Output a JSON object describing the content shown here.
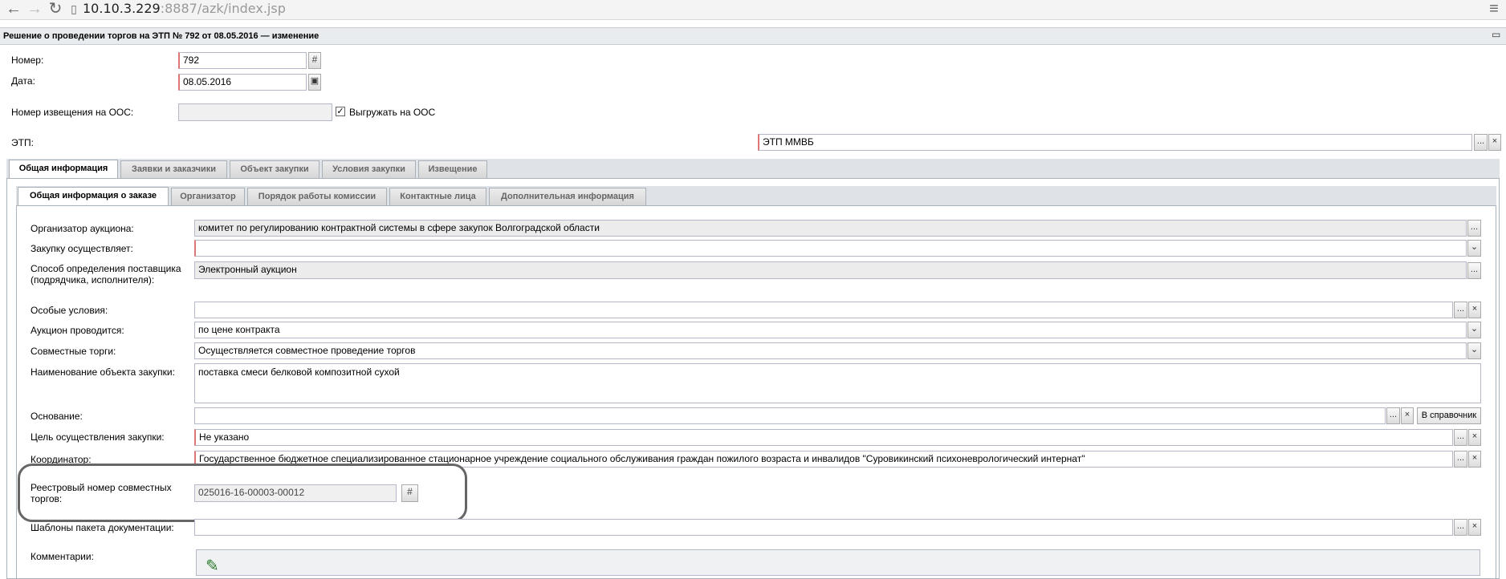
{
  "browser": {
    "back_icon": "←",
    "forward_icon": "→",
    "reload_icon": "↻",
    "page_icon": "▯",
    "url_host": "10.10.3.229",
    "url_rest": ":8887/azk/index.jsp",
    "menu_icon": "≡"
  },
  "window": {
    "title": "Решение о проведении торгов на ЭТП № 792 от 08.05.2016 — изменение",
    "maximize_icon": "▭"
  },
  "header": {
    "number_label": "Номер:",
    "number_value": "792",
    "date_label": "Дата:",
    "date_value": "08.05.2016",
    "oos_notice_label": "Номер извещения на ООС:",
    "oos_notice_value": "",
    "export_oos_label": "Выгружать на ООС",
    "export_oos_checked": "✓",
    "etp_label": "ЭТП:",
    "etp_value": "ЭТП ММВБ"
  },
  "main_tabs": [
    {
      "label": "Общая информация"
    },
    {
      "label": "Заявки и заказчики"
    },
    {
      "label": "Объект закупки"
    },
    {
      "label": "Условия закупки"
    },
    {
      "label": "Извещение"
    }
  ],
  "sub_tabs": [
    {
      "label": "Общая информация о заказе"
    },
    {
      "label": "Организатор"
    },
    {
      "label": "Порядок работы комиссии"
    },
    {
      "label": "Контактные лица"
    },
    {
      "label": "Дополнительная информация"
    }
  ],
  "form": {
    "organizer_label": "Организатор аукциона:",
    "organizer_value": "комитет по регулированию контрактной системы в сфере закупок Волгоградской области",
    "purchaser_label": "Закупку осуществляет:",
    "purchaser_value": "",
    "method_label_1": "Способ определения поставщика",
    "method_label_2": "(подрядчика, исполнителя):",
    "method_value": "Электронный аукцион",
    "special_label": "Особые условия:",
    "special_value": "",
    "auction_label": "Аукцион проводится:",
    "auction_value": "по цене контракта",
    "joint_label": "Совместные торги:",
    "joint_value": "Осуществляется совместное проведение торгов",
    "object_label": "Наименование объекта закупки:",
    "object_value": "поставка смеси белковой композитной сухой",
    "basis_label": "Основание:",
    "basis_value": "",
    "directory_button": "В справочник",
    "goal_label": "Цель осуществления закупки:",
    "goal_value": "Не указано",
    "coordinator_label": "Координатор:",
    "coordinator_value": "Государственное бюджетное специализированное стационарное учреждение социального обслуживания граждан пожилого возраста и инвалидов \"Суровикинский психоневрологический интернат\"",
    "registry_label_1": "Реестровый номер совместных",
    "registry_label_2": "торгов:",
    "registry_value": "025016-16-00003-00012",
    "templates_label": "Шаблоны пакета документации:",
    "templates_value": "",
    "comments_label": "Комментарии:"
  },
  "icons": {
    "ellipsis": "...",
    "clear": "×",
    "dropdown": "⌄",
    "grid": "#",
    "calendar": "▣",
    "edit": "✎"
  }
}
